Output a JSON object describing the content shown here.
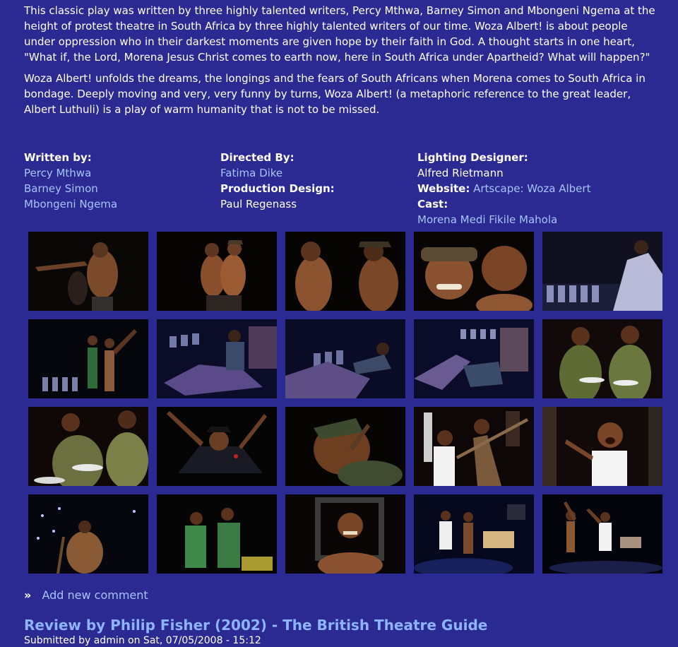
{
  "description": {
    "p1": "This classic play was written by three highly talented writers, Percy Mthwa, Barney Simon and Mbongeni Ngema at the height of protest theatre in South Africa by three highly talented writers of our time. Woza Albert! is about people under oppression who in their darkest moments are given hope by their faith in God. A thought starts in one heart, \"What if, the Lord, Morena Jesus Christ comes to earth now, here in South Africa under Apartheid? What will happen?\"",
    "p2": "Woza Albert! unfolds the dreams, the longings and the fears of South Africans when Morena comes to South Africa in bondage. Deeply moving and very, very funny by turns, Woza Albert! (a metaphoric reference to the great leader, Albert Luthuli) is a play of warm humanity that is not to be missed."
  },
  "credits": {
    "written_by": {
      "label": "Written by:",
      "names": [
        "Percy Mthwa",
        "Barney Simon",
        "Mbongeni Ngema"
      ]
    },
    "directed_by": {
      "label": "Directed By:",
      "name": "Fatima Dike"
    },
    "production_design": {
      "label": "Production Design:",
      "name": "Paul Regenass"
    },
    "lighting_designer": {
      "label": "Lighting Designer:",
      "name": "Alfred Rietmann"
    },
    "website": {
      "label": "Website:",
      "link": "Artscape: Woza Albert"
    },
    "cast": {
      "label": "Cast:",
      "names": "Morena Medi Fikile Mahola"
    }
  },
  "gallery": {
    "photo_count": 20
  },
  "comment_link": "Add new comment",
  "comment_bullet": "»",
  "review_title": "Review by Philip Fisher (2002) - The British Theatre Guide",
  "submitted": "Submitted by admin on Sat, 07/05/2008 - 15:12",
  "colors": {
    "background": "#2b2a93",
    "link": "#a6c4ff",
    "review_title": "#8fb4ff"
  }
}
